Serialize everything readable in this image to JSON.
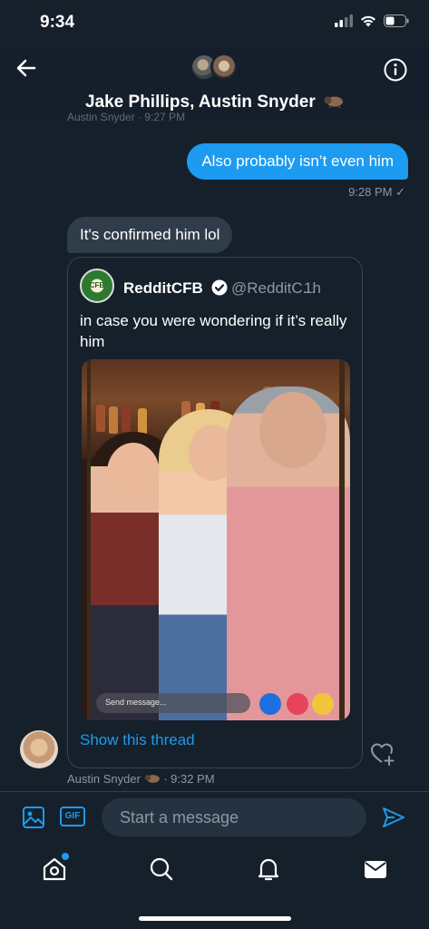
{
  "status_bar": {
    "time": "9:34"
  },
  "header": {
    "title": "Jake Phillips, Austin Snyder"
  },
  "ghost_meta": "Austin Snyder · 9:27 PM",
  "messages": {
    "outgoing": {
      "text": "Also probably isn’t even him",
      "meta": "9:28 PM ✓"
    },
    "incoming": {
      "text": "It's confirmed him lol"
    }
  },
  "tweet": {
    "name": "RedditCFB",
    "avatar_text": "CFB",
    "handle": "@RedditC...",
    "time": "1h",
    "text": "in case you were wondering if it’s really him",
    "media_message_placeholder": "Send message...",
    "show_thread": "Show this thread"
  },
  "incoming_meta": {
    "sender": "Austin Snyder",
    "time": "· 9:32 PM"
  },
  "composer": {
    "placeholder": "Start a message",
    "gif_label": "GIF"
  },
  "colors": {
    "background": "#15202b",
    "accent": "#1d9bf0",
    "bubble_in": "#2f3d4a",
    "muted": "#8b98a5"
  },
  "icons": [
    "back-arrow-icon",
    "info-icon",
    "verified-badge-icon",
    "heart-add-icon",
    "image-icon",
    "gif-icon",
    "send-icon",
    "home-icon",
    "search-icon",
    "bell-icon",
    "mail-icon"
  ]
}
